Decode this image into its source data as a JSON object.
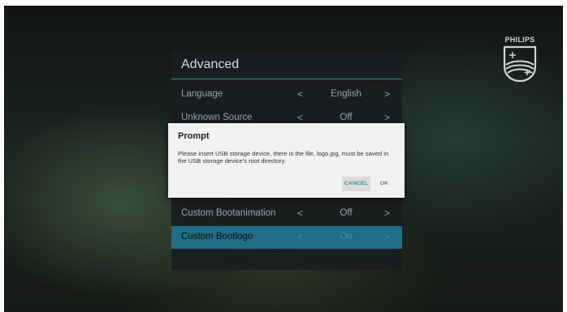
{
  "brand": {
    "name": "PHILIPS"
  },
  "panel": {
    "title": "Advanced",
    "rows": [
      {
        "label": "Language",
        "value": "English",
        "selected": false
      },
      {
        "label": "Unknown Source",
        "value": "Off",
        "selected": false
      },
      {
        "label": "Custom Bootanimation",
        "value": "Off",
        "selected": false
      },
      {
        "label": "Custom Bootlogo",
        "value": "On",
        "selected": true
      }
    ],
    "chevron_left": "<",
    "chevron_right": ">"
  },
  "dialog": {
    "title": "Prompt",
    "message": "Please insert USB storage device, there is the file, logo.jpg, must be saved in the USB storage device's root directory.",
    "cancel_label": "CANCEL",
    "ok_label": "OK"
  },
  "colors": {
    "accent": "#1f6d86",
    "button_text": "#1f9ab5",
    "dialog_bg": "#f1f1f1"
  }
}
